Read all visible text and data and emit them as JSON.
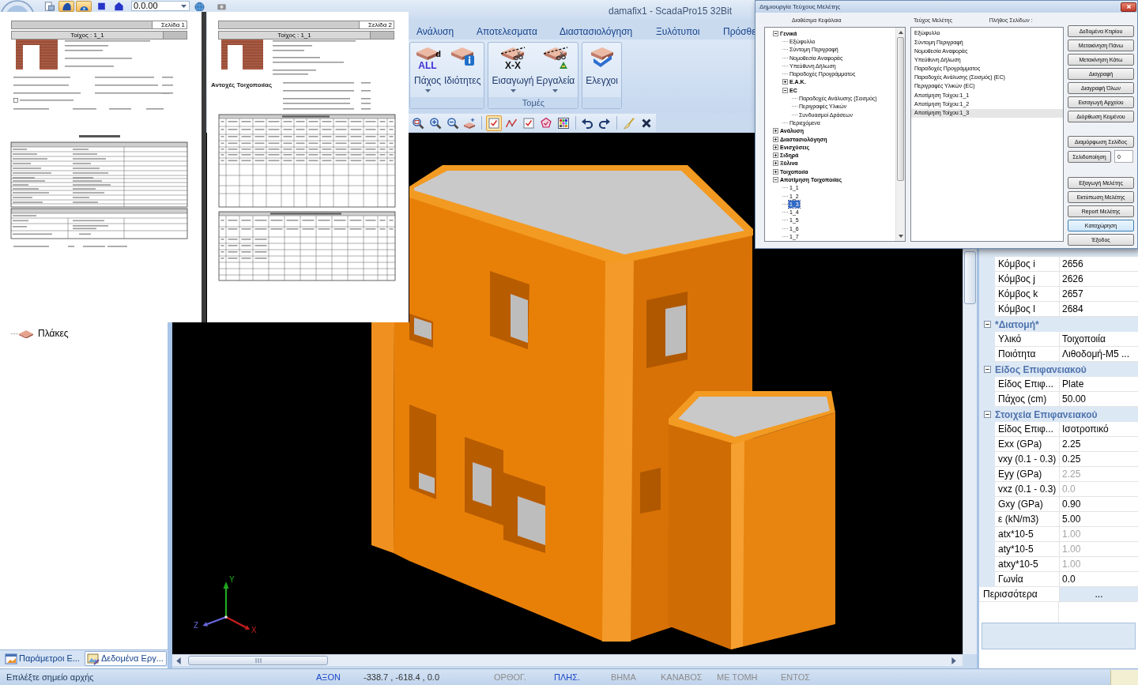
{
  "window": {
    "title": "damafix1 - ScadaPro15 32Bit"
  },
  "quick_access": {
    "tools": [
      {
        "kind": "preview",
        "pressed": false
      },
      {
        "kind": "model",
        "pressed": true
      },
      {
        "kind": "view",
        "pressed": true
      },
      {
        "kind": "square",
        "pressed": false
      },
      {
        "kind": "house",
        "pressed": false
      }
    ],
    "level": {
      "value": "0.0.00"
    },
    "more_tools": [
      {
        "kind": "globe",
        "pressed": false
      },
      {
        "kind": "camera",
        "pressed": false
      }
    ]
  },
  "ribbon": {
    "tabs": [
      {
        "label": "Ανάλυση",
        "selected": false
      },
      {
        "label": "Αποτελεσματα",
        "selected": false
      },
      {
        "label": "Διαστασιολόγηση",
        "selected": false
      },
      {
        "label": "Ξυλότυποι",
        "selected": false
      },
      {
        "label": "Πρόσθε",
        "selected": false
      }
    ],
    "groups": [
      {
        "buttons": [
          {
            "label": "Πάχος",
            "kind": "all",
            "dropdown": true,
            "icon_text": "ALL",
            "icon_mark": "d"
          },
          {
            "label": "Ιδιότητες",
            "kind": "info",
            "dropdown": false
          }
        ]
      },
      {
        "label": "Τομές",
        "buttons": [
          {
            "label": "Εισαγωγή",
            "kind": "cut",
            "dropdown": true,
            "icon_text": "X-X"
          },
          {
            "label": "Εργαλεία",
            "kind": "tools",
            "dropdown": true
          }
        ]
      },
      {
        "buttons": [
          {
            "label": "Ελεγχοι",
            "kind": "check",
            "dropdown": false
          }
        ]
      }
    ]
  },
  "toolbar": [
    {
      "tools": [
        {
          "kind": "zoom-window",
          "pressed": false
        },
        {
          "kind": "zoom-in",
          "pressed": false
        },
        {
          "kind": "zoom-out",
          "pressed": false
        },
        {
          "kind": "slab-star",
          "pressed": false
        }
      ]
    },
    {
      "tools": [
        {
          "kind": "checkbox",
          "pressed": true
        },
        {
          "kind": "polyline",
          "pressed": false
        },
        {
          "kind": "checkbox",
          "pressed": false
        },
        {
          "kind": "pentagon",
          "pressed": false
        },
        {
          "kind": "grid",
          "pressed": false
        }
      ]
    },
    {
      "tools": [
        {
          "kind": "undo",
          "pressed": false
        },
        {
          "kind": "redo",
          "pressed": false
        }
      ]
    },
    {
      "tools": [
        {
          "kind": "brush",
          "pressed": false
        },
        {
          "kind": "cross",
          "pressed": false
        }
      ]
    }
  ],
  "report_preview": {
    "pages": [
      {
        "kind": "summary",
        "page_label": "Σελίδα 1",
        "wall_title": "Τοίχος : 1_1"
      },
      {
        "kind": "results",
        "page_label": "Σελίδα 2",
        "wall_title": "Τοίχος : 1_1",
        "section_label": "Αντοχές Τοιχοποιίας"
      }
    ]
  },
  "left_panel": {
    "tree": [
      {
        "label": "Πλάκες",
        "selected": false
      }
    ],
    "tabs": [
      {
        "label": "Παράμετροι Ε...",
        "selected": false
      },
      {
        "label": "Δεδομένα Εργ...",
        "selected": true
      }
    ]
  },
  "viewport": {
    "axes": [
      {
        "label": "Y",
        "color": "#1fa81f"
      },
      {
        "label": "X",
        "color": "#c81e1e"
      },
      {
        "label": "Z",
        "color": "#6a6ae0"
      }
    ]
  },
  "properties": {
    "sections": [
      {
        "rows": [
          {
            "name": "Κόμβος i",
            "value": "2656",
            "disabled": false
          },
          {
            "name": "Κόμβος j",
            "value": "2626",
            "disabled": false
          },
          {
            "name": "Κόμβος k",
            "value": "2657",
            "disabled": false
          },
          {
            "name": "Κόμβος l",
            "value": "2684",
            "disabled": false
          }
        ]
      },
      {
        "label": "*Διατομή*",
        "expanded": true,
        "rows": [
          {
            "name": "Υλικό",
            "value": "Τοιχοποιία",
            "disabled": false
          },
          {
            "name": "Ποιότητα",
            "value": "Λιθοδομή-M5 ...",
            "disabled": false
          }
        ]
      },
      {
        "label": "Είδος Επιφανειακού",
        "expanded": true,
        "rows": [
          {
            "name": "Είδος Επιφ...",
            "value": "Plate",
            "disabled": false
          },
          {
            "name": "Πάχος (cm)",
            "value": "50.00",
            "disabled": false
          }
        ]
      },
      {
        "label": "Στοιχεία Επιφανειακού",
        "expanded": true,
        "rows": [
          {
            "name": "Είδος Επιφ...",
            "value": "Ισοτροπικό",
            "disabled": false
          },
          {
            "name": "Exx (GPa)",
            "value": "2.25",
            "disabled": false
          },
          {
            "name": "vxy (0.1 - 0.3)",
            "value": "0.25",
            "disabled": false
          },
          {
            "name": "Eyy (GPa)",
            "value": "2.25",
            "disabled": true
          },
          {
            "name": "vxz (0.1 - 0.3)",
            "value": "0.0",
            "disabled": true
          },
          {
            "name": "Gxy (GPa)",
            "value": "0.90",
            "disabled": false
          },
          {
            "name": "ε (kN/m3)",
            "value": "5.00",
            "disabled": false
          },
          {
            "name": "atx*10-5",
            "value": "1.00",
            "disabled": true
          },
          {
            "name": "aty*10-5",
            "value": "1.00",
            "disabled": true
          },
          {
            "name": "atxy*10-5",
            "value": "1.00",
            "disabled": true
          },
          {
            "name": "Γωνία",
            "value": "0.0",
            "disabled": false
          }
        ]
      }
    ],
    "more": {
      "label": "Περισσότερα",
      "value": "..."
    }
  },
  "dialog": {
    "title": "Δημιουργία Τεύχους Μελέτης",
    "chapters_heading": "Διαθέσιμα Κεφάλαια",
    "contents_heading": "Τεύχος Μελέτης",
    "pages_heading": "Πλήθος Σελίδων :",
    "chapters": [
      {
        "label": "Γενικά",
        "expanded": true,
        "selected": false,
        "children": [
          {
            "label": "Εξώφυλλο",
            "selected": false
          },
          {
            "label": "Σύντομη Περιγραφή",
            "selected": false
          },
          {
            "label": "Νομοθεσία Αναφοράς",
            "selected": false
          },
          {
            "label": "Υπεύθυνη Δήλωση",
            "selected": false
          },
          {
            "label": "Παραδοχές Προγράμματος",
            "selected": false
          },
          {
            "label": "Ε.Α.Κ.",
            "expanded": false,
            "selected": false
          },
          {
            "label": "EC",
            "expanded": true,
            "selected": false,
            "children": [
              {
                "label": "Παραδοχές Ανάλυσης (Σεισμός)",
                "selected": false
              },
              {
                "label": "Περιγραφές Υλικών",
                "selected": false
              },
              {
                "label": "Συνδυασμοί Δράσεων",
                "selected": false
              }
            ]
          },
          {
            "label": "Περιεχόμενα",
            "selected": false
          }
        ]
      },
      {
        "label": "Ανάλυση",
        "expanded": false,
        "selected": false
      },
      {
        "label": "Διαστασιολόγηση",
        "expanded": false,
        "selected": false
      },
      {
        "label": "Ενισχύσεις",
        "expanded": false,
        "selected": false
      },
      {
        "label": "Σιδηρά",
        "expanded": false,
        "selected": false
      },
      {
        "label": "Ξύλινα",
        "expanded": false,
        "selected": false
      },
      {
        "label": "Τοιχοποιία",
        "expanded": false,
        "selected": false
      },
      {
        "label": "Αποτίμηση Τοιχοποιίας",
        "expanded": true,
        "selected": false,
        "children": [
          {
            "label": "1_1",
            "selected": false
          },
          {
            "label": "1_2",
            "selected": false
          },
          {
            "label": "1_3",
            "selected": true
          },
          {
            "label": "1_4",
            "selected": false
          },
          {
            "label": "1_5",
            "selected": false
          },
          {
            "label": "1_6",
            "selected": false
          },
          {
            "label": "1_7",
            "selected": false
          }
        ]
      }
    ],
    "contents": [
      {
        "label": "Εξώφυλλο",
        "selected": false
      },
      {
        "label": "Σύντομη Περιγραφή",
        "selected": false
      },
      {
        "label": "Νομοθεσία Αναφοράς",
        "selected": false
      },
      {
        "label": "Υπεύθυνη Δήλωση",
        "selected": false
      },
      {
        "label": "Παραδοχές Προγράμματος",
        "selected": false
      },
      {
        "label": "Παραδοχές Ανάλυσης (Σεισμός) (EC)",
        "selected": false
      },
      {
        "label": "Περιγραφές Υλικών (EC)",
        "selected": false
      },
      {
        "label": "Αποτίμηση Τοίχου:1_1",
        "selected": false
      },
      {
        "label": "Αποτίμηση Τοίχου:1_2",
        "selected": false
      },
      {
        "label": "Αποτίμηση Τοίχου:1_3",
        "selected": true
      }
    ],
    "button_groups": [
      {
        "buttons": [
          {
            "label": "Δεδομένα Κτιρίου",
            "default": false
          },
          {
            "label": "Μετακίνηση Πάνω",
            "default": false
          },
          {
            "label": "Μετακίνηση Κάτω",
            "default": false
          },
          {
            "label": "Διαγραφή",
            "default": false
          },
          {
            "label": "Διαγραφή Όλων",
            "default": false
          },
          {
            "label": "Εισαγωγή Αρχείου",
            "default": false
          },
          {
            "label": "Διόρθωση Κειμένου",
            "default": false
          }
        ]
      },
      {
        "buttons": [
          {
            "label": "Διαμόρφωση Σελίδος",
            "default": false
          },
          {
            "label": "Σελιδοποίηση",
            "default": false,
            "field_value": "0"
          }
        ]
      },
      {
        "buttons": [
          {
            "label": "Εξαγωγή Μελέτης",
            "default": false
          },
          {
            "label": "Εκτύπωση Μελέτης",
            "default": false
          },
          {
            "label": "Report Μελέτης",
            "default": false
          },
          {
            "label": "Καταχώρηση",
            "default": true
          },
          {
            "label": "Έξοδος",
            "default": false
          }
        ]
      }
    ]
  },
  "status_bar": {
    "message": "Επιλέξτε σημείο αρχής",
    "items": [
      {
        "kind": "toggle",
        "label": "ΑΞΟΝ",
        "on": true
      },
      {
        "kind": "readout",
        "label": "-338.7 , -618.4 , 0.0"
      },
      {
        "kind": "toggle",
        "label": "ΟΡΘΟΓ.",
        "on": false
      },
      {
        "kind": "toggle",
        "label": "ΠΛΗΣ.",
        "on": true
      },
      {
        "kind": "toggle",
        "label": "ΒΗΜΑ",
        "on": false
      },
      {
        "kind": "toggle",
        "label": "ΚΑΝΑΒΟΣ",
        "on": false
      },
      {
        "kind": "toggle",
        "label": "ΜΕ ΤΟΜΗ",
        "on": false
      },
      {
        "kind": "toggle",
        "label": "ΕΝΤΟΣ",
        "on": false
      }
    ]
  }
}
